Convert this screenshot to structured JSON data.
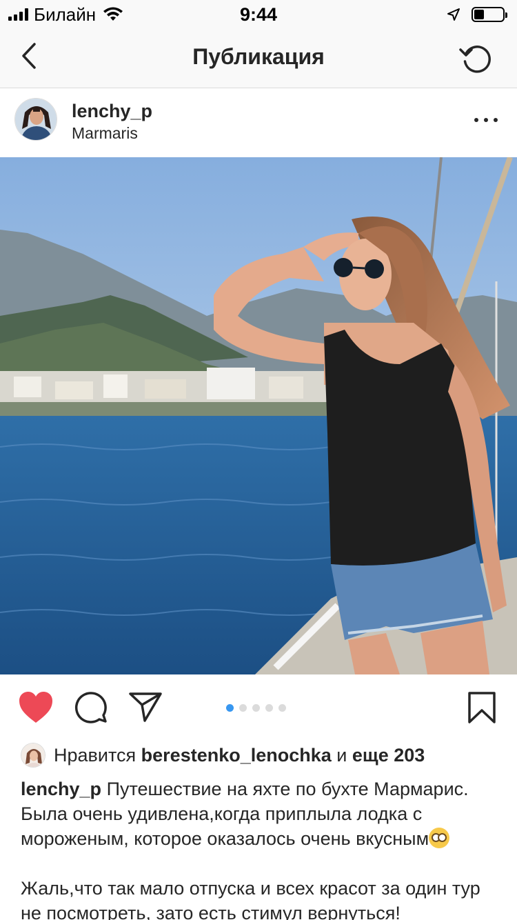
{
  "status_bar": {
    "carrier": "Билайн",
    "time": "9:44",
    "battery_level": 0.35
  },
  "nav": {
    "title": "Публикация",
    "back_icon": "chevron-left-icon",
    "refresh_icon": "refresh-icon"
  },
  "post": {
    "username": "lenchy_p",
    "location": "Marmaris",
    "carousel": {
      "total": 5,
      "active": 1
    },
    "liked": true,
    "likes": {
      "prefix": "Нравится",
      "user": "berestenko_lenochka",
      "connector": "и",
      "others": "еще 203"
    },
    "caption": {
      "author": "lenchy_p",
      "line1": "Путешествие на яхте по бухте Мармарис. Была очень удивлена,когда приплыла лодка с мороженым, которое оказалось очень вкусным",
      "line2": "Жаль,что так мало отпуска и всех красот за один тур не посмотреть, зато есть стимул вернуться!"
    }
  },
  "colors": {
    "heart": "#ed4956",
    "dot_active": "#3897f0",
    "dot_inactive": "#dbdbdb",
    "text": "#262626"
  }
}
